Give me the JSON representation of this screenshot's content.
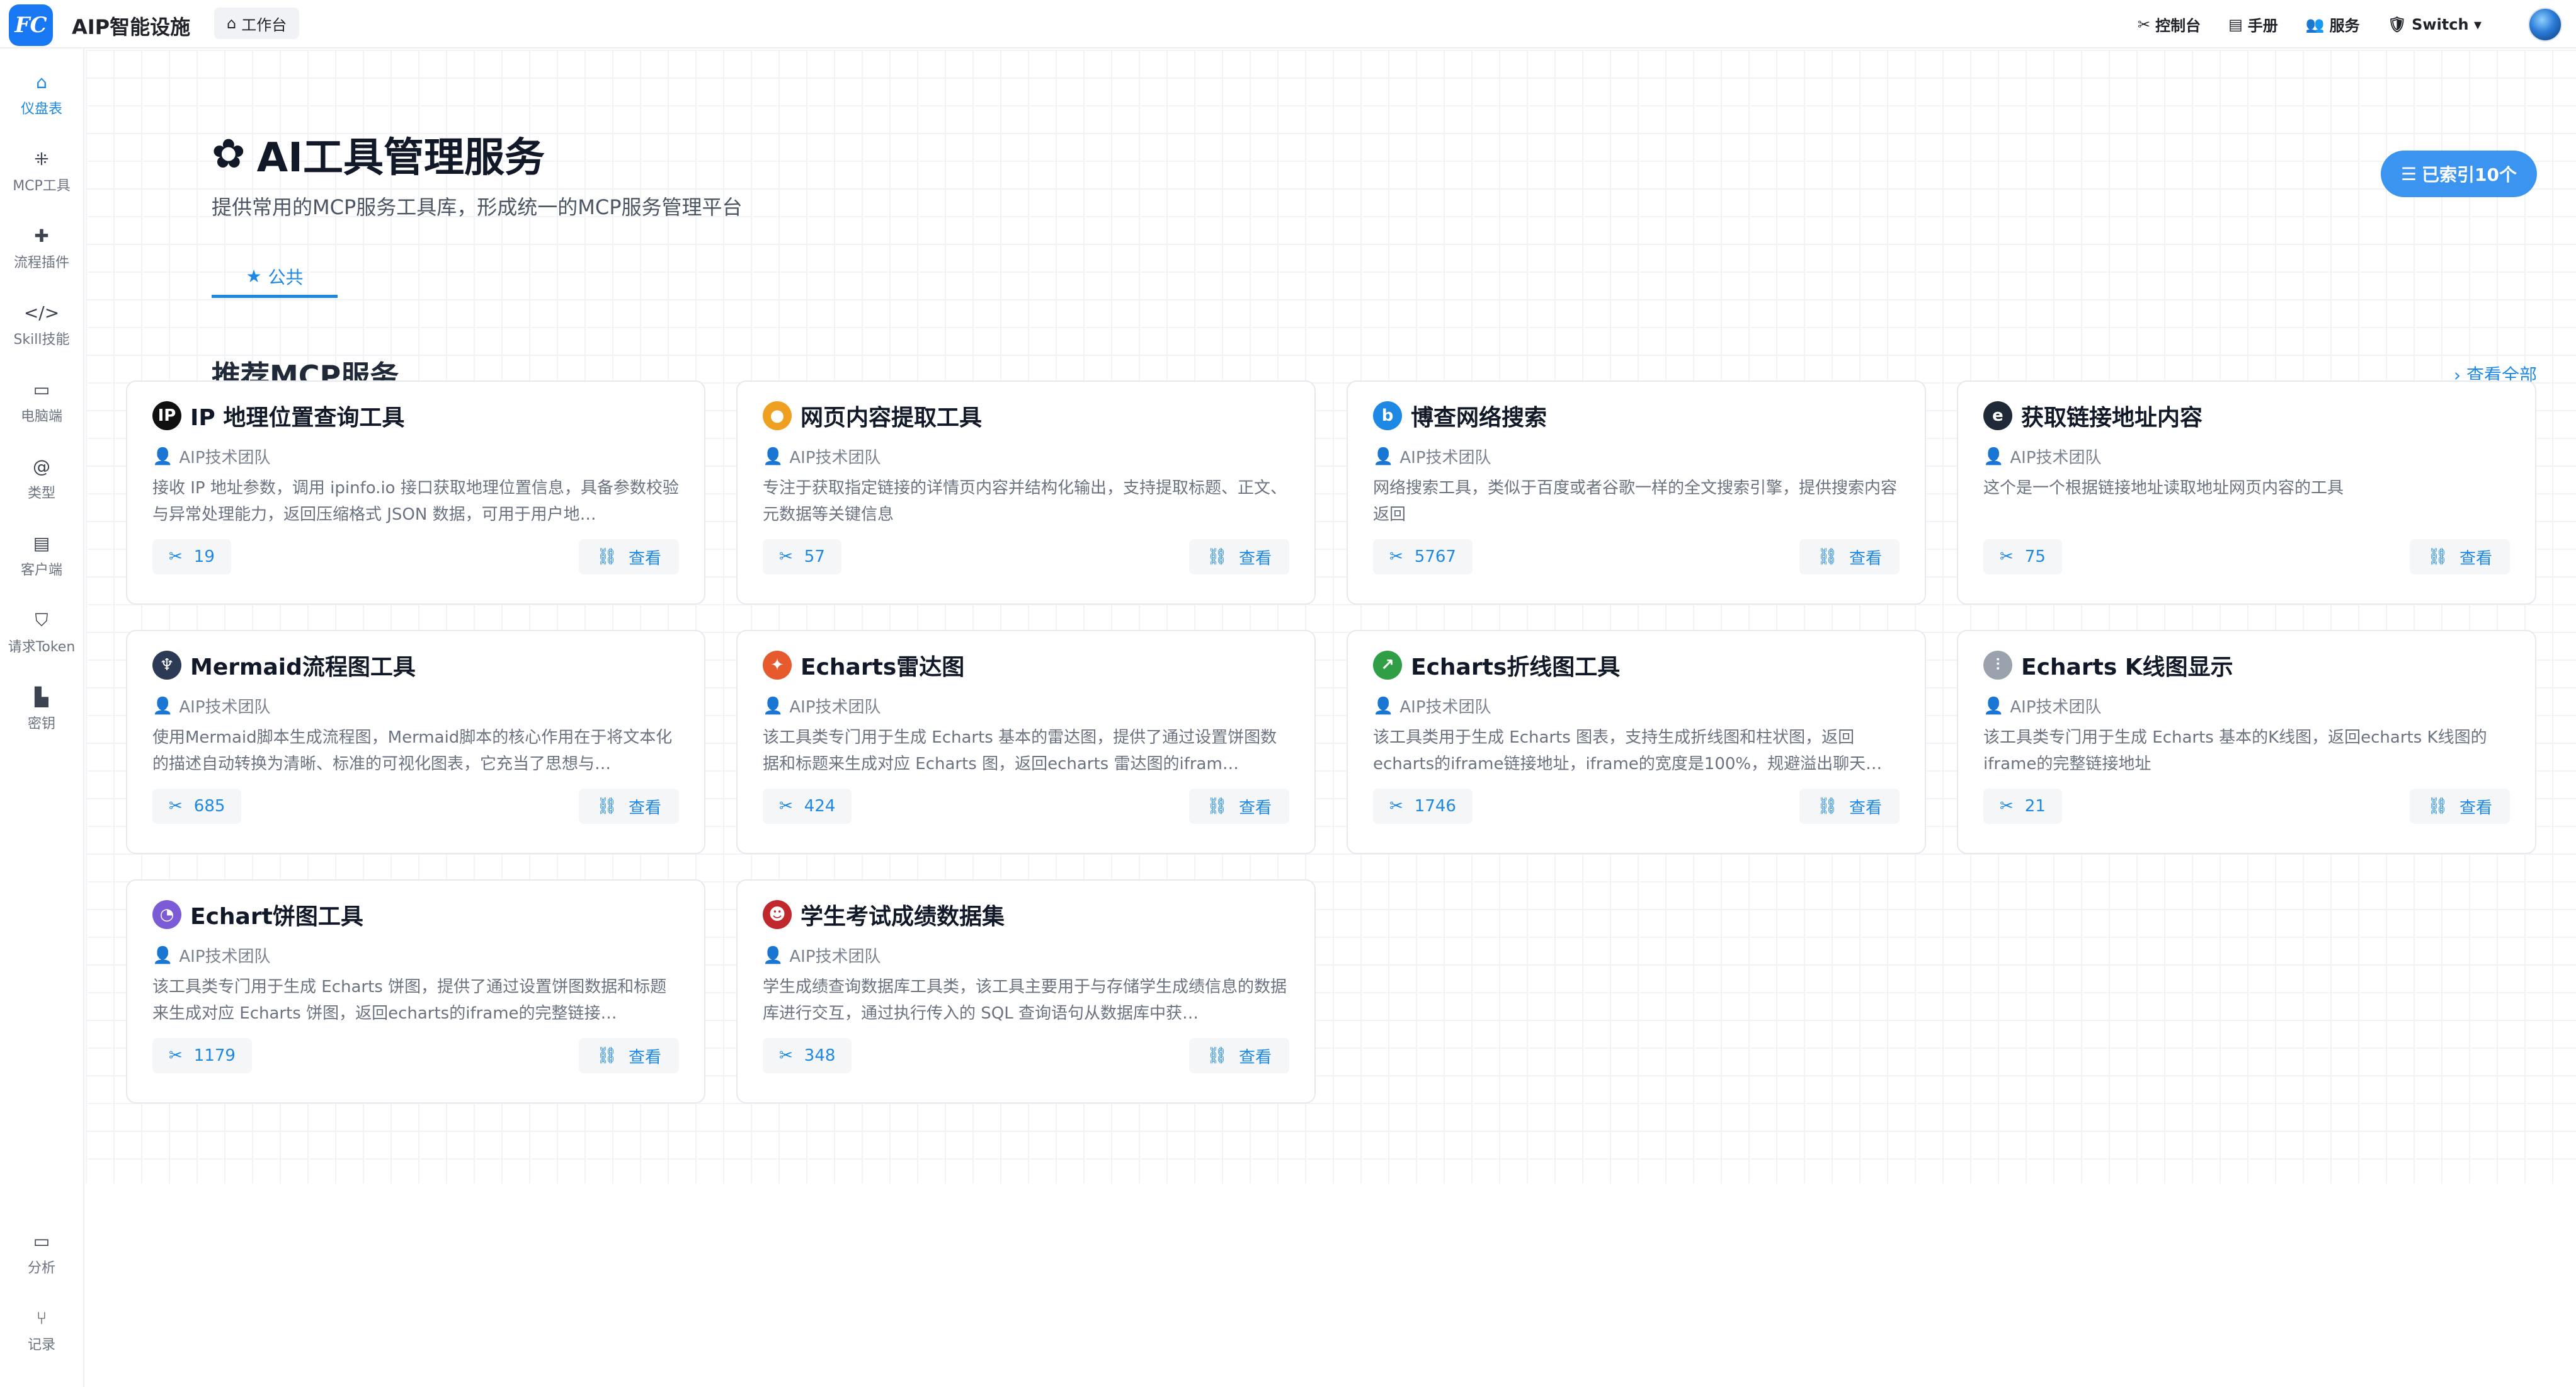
{
  "topbar": {
    "logo_text": "FC",
    "app_title": "AIP智能设施",
    "workbench_label": "工作台",
    "links": [
      {
        "icon": "tools-icon",
        "glyph": "✂",
        "label": "控制台"
      },
      {
        "icon": "manual-icon",
        "glyph": "▤",
        "label": "手册"
      },
      {
        "icon": "users-icon",
        "glyph": "👥",
        "label": "服务"
      },
      {
        "icon": "shield-icon",
        "glyph": "🛡",
        "label": "Switch ▾"
      }
    ]
  },
  "sidebar": {
    "items": [
      {
        "label": "仪盘表",
        "icon": "home-icon",
        "glyph": "⌂",
        "active": true
      },
      {
        "label": "MCP工具",
        "icon": "grid-icon",
        "glyph": "⁜",
        "active": false
      },
      {
        "label": "流程插件",
        "icon": "puzzle-icon",
        "glyph": "✚",
        "active": false
      },
      {
        "label": "Skill技能",
        "icon": "code-icon",
        "glyph": "</>",
        "active": false
      },
      {
        "label": "电脑端",
        "icon": "desktop-icon",
        "glyph": "▭",
        "active": false
      },
      {
        "label": "类型",
        "icon": "at-icon",
        "glyph": "@",
        "active": false
      },
      {
        "label": "客户端",
        "icon": "server-icon",
        "glyph": "▤",
        "active": false
      },
      {
        "label": "请求Token",
        "icon": "shield-icon",
        "glyph": "⛉",
        "active": false
      },
      {
        "label": "密钥",
        "icon": "key-file-icon",
        "glyph": "▙",
        "active": false
      }
    ],
    "bottom_items": [
      {
        "label": "分析",
        "icon": "devices-icon",
        "glyph": "▭"
      },
      {
        "label": "记录",
        "icon": "git-icon",
        "glyph": "⑂"
      }
    ]
  },
  "header": {
    "title": "AI工具管理服务",
    "subtitle": "提供常用的MCP服务工具库，形成统一的MCP服务管理平台",
    "indexed_label": "已索引10个",
    "tab_label": "公共"
  },
  "section": {
    "title": "推荐MCP服务",
    "view_all": "查看全部"
  },
  "cards": [
    {
      "title": "IP 地理位置查询工具",
      "icon": "map-pin-icon",
      "icon_glyph": "IP",
      "icon_color": "#111111",
      "author": "AIP技术团队",
      "desc": "接收 IP 地址参数，调用 ipinfo.io 接口获取地理位置信息，具备参数校验与异常处理能力，返回压缩格式 JSON 数据，可用于用户地…",
      "count": "19",
      "view": "查看"
    },
    {
      "title": "网页内容提取工具",
      "icon": "coin-icon",
      "icon_glyph": "●",
      "icon_color": "#f0a020",
      "author": "AIP技术团队",
      "desc": "专注于获取指定链接的详情页内容并结构化输出，支持提取标题、正文、元数据等关键信息",
      "count": "57",
      "view": "查看"
    },
    {
      "title": "博查网络搜索",
      "icon": "bocha-logo-icon",
      "icon_glyph": "b",
      "icon_color": "#1e88e5",
      "author": "AIP技术团队",
      "desc": "网络搜索工具，类似于百度或者谷歌一样的全文搜索引擎，提供搜索内容返回",
      "count": "5767",
      "view": "查看"
    },
    {
      "title": "获取链接地址内容",
      "icon": "link-globe-icon",
      "icon_glyph": "e",
      "icon_color": "#1f2937",
      "author": "AIP技术团队",
      "desc": "这个是一个根据链接地址读取地址网页内容的工具",
      "count": "75",
      "view": "查看"
    },
    {
      "title": "Mermaid流程图工具",
      "icon": "mermaid-icon",
      "icon_glyph": "♆",
      "icon_color": "#2d3a55",
      "author": "AIP技术团队",
      "desc": "使用Mermaid脚本生成流程图，Mermaid脚本的核心作用在于将文本化的描述自动转换为清晰、标准的可视化图表，它充当了思想与…",
      "count": "685",
      "view": "查看"
    },
    {
      "title": "Echarts雷达图",
      "icon": "radar-chart-icon",
      "icon_glyph": "✦",
      "icon_color": "#e65a2e",
      "author": "AIP技术团队",
      "desc": "该工具类专门用于生成 Echarts 基本的雷达图，提供了通过设置饼图数据和标题来生成对应 Echarts 图，返回echarts 雷达图的ifram…",
      "count": "424",
      "view": "查看"
    },
    {
      "title": "Echarts折线图工具",
      "icon": "line-chart-icon",
      "icon_glyph": "↗",
      "icon_color": "#2f9e44",
      "author": "AIP技术团队",
      "desc": "该工具类用于生成 Echarts 图表，支持生成折线图和柱状图，返回echarts的iframe链接地址，iframe的宽度是100%，规避溢出聊天…",
      "count": "1746",
      "view": "查看"
    },
    {
      "title": "Echarts K线图显示",
      "icon": "candlestick-chart-icon",
      "icon_glyph": "⫶",
      "icon_color": "#9aa3ad",
      "author": "AIP技术团队",
      "desc": "该工具类专门用于生成 Echarts 基本的K线图，返回echarts K线图的iframe的完整链接地址",
      "count": "21",
      "view": "查看"
    },
    {
      "title": "Echart饼图工具",
      "icon": "pie-chart-icon",
      "icon_glyph": "◔",
      "icon_color": "#7c5cd6",
      "author": "AIP技术团队",
      "desc": "该工具类专门用于生成 Echarts 饼图，提供了通过设置饼图数据和标题来生成对应 Echarts 饼图，返回echarts的iframe的完整链接…",
      "count": "1179",
      "view": "查看"
    },
    {
      "title": "学生考试成绩数据集",
      "icon": "student-avatar-icon",
      "icon_glyph": "☻",
      "icon_color": "#c0282d",
      "author": "AIP技术团队",
      "desc": "学生成绩查询数据库工具类，该工具主要用于与存储学生成绩信息的数据库进行交互，通过执行传入的 SQL 查询语句从数据库中获…",
      "count": "348",
      "view": "查看"
    }
  ]
}
